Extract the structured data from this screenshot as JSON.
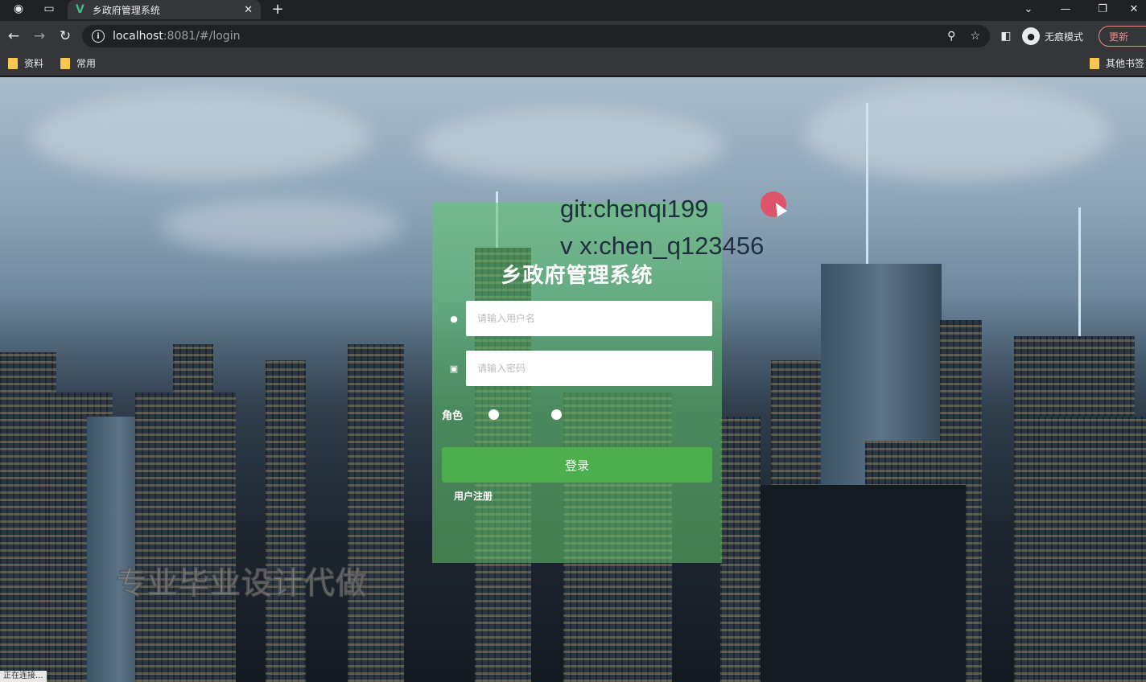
{
  "browser": {
    "tab_title": "乡政府管理系统",
    "tab_favicon": "vue-logo-icon",
    "url_host": "localhost",
    "url_rest": ":8081/#/login",
    "incognito_label": "无痕模式",
    "update_label": "更新",
    "bookmarks": [
      "资料",
      "常用"
    ],
    "other_bookmarks": "其他书签",
    "status_text": "正在连接..."
  },
  "login": {
    "title": "乡政府管理系统",
    "username_placeholder": "请输入用户名",
    "password_placeholder": "请输入密码",
    "role_label": "角色",
    "login_button": "登录",
    "register_link": "用户注册"
  },
  "watermarks": {
    "git": "git:chenqi199",
    "vx": "v x:chen_q123456",
    "ad": "专业毕业设计代做"
  },
  "colors": {
    "panel_green": "#60c86e",
    "button_green": "#4cae4c"
  }
}
